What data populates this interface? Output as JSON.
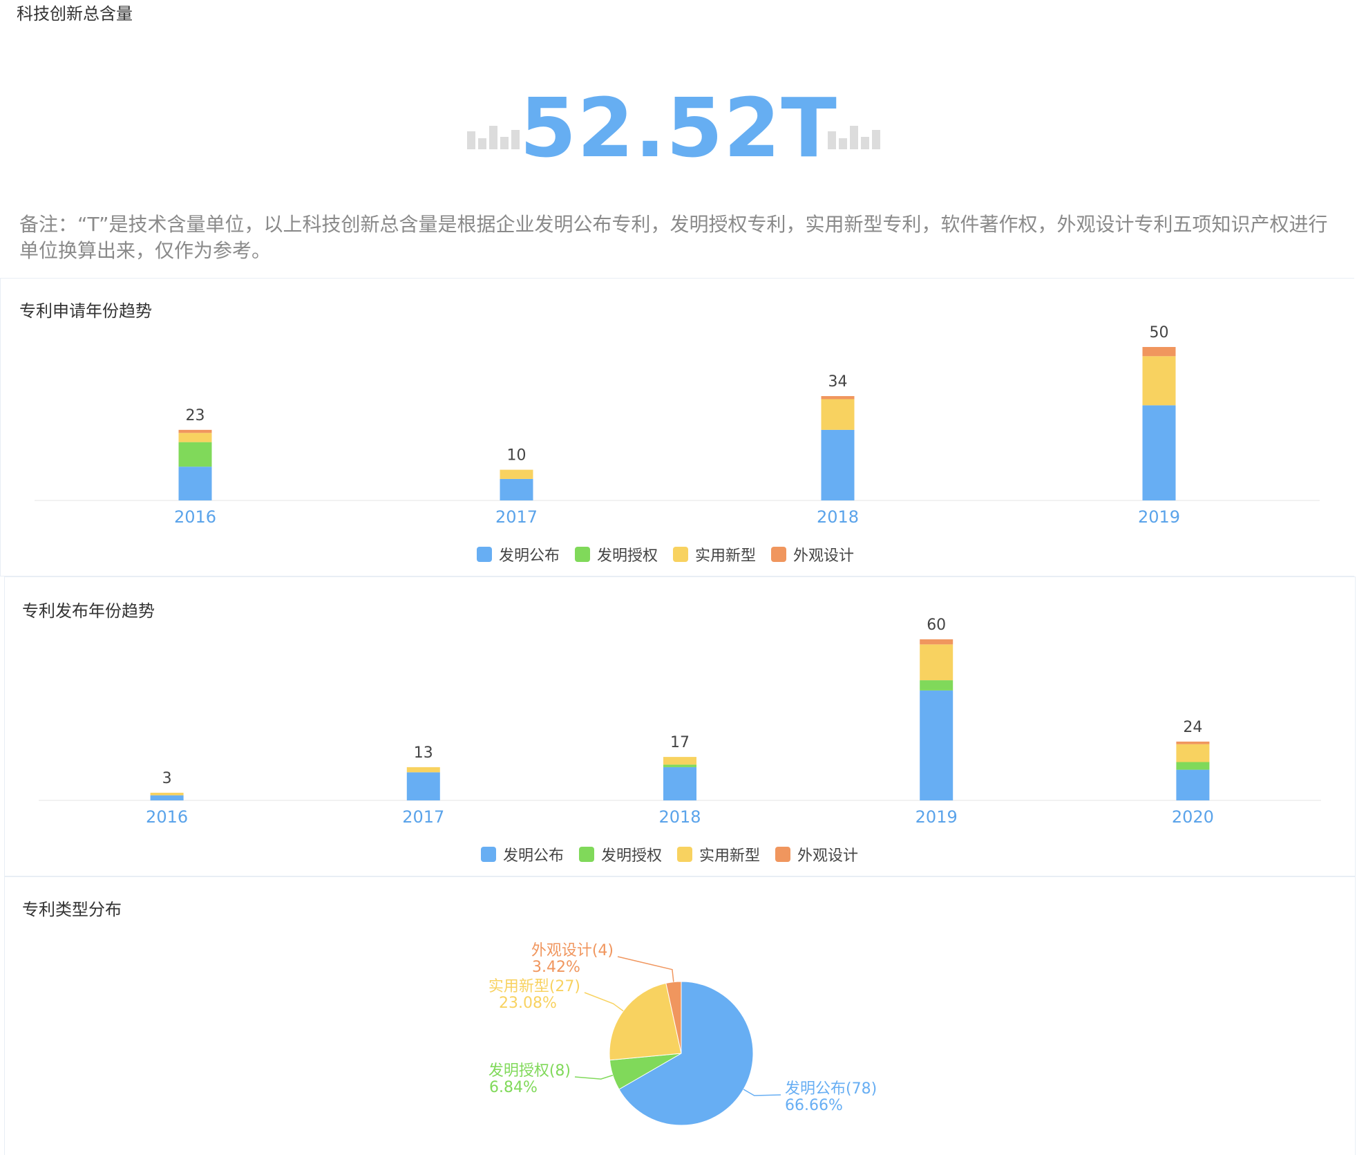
{
  "header": {
    "title": "科技创新总含量",
    "value": "52.52T",
    "note": "备注：“T”是技术含量单位，以上科技创新总含量是根据企业发明公布专利，发明授权专利，实用新型专利，软件著作权，外观设计专利五项知识产权进行单位换算出来，仅作为参考。"
  },
  "colors": {
    "invention_publish": "#67aef3",
    "invention_grant": "#80d95a",
    "utility_model": "#f8d260",
    "design": "#f0965e",
    "value": "#66aef2"
  },
  "chart_data": [
    {
      "type": "bar",
      "stacked": true,
      "title": "专利申请年份趋势",
      "categories": [
        "2016",
        "2017",
        "2018",
        "2019"
      ],
      "series": [
        {
          "name": "发明公布",
          "values": [
            11,
            7,
            23,
            31
          ]
        },
        {
          "name": "发明授权",
          "values": [
            8,
            0,
            0,
            0
          ]
        },
        {
          "name": "实用新型",
          "values": [
            3,
            3,
            10,
            16
          ]
        },
        {
          "name": "外观设计",
          "values": [
            1,
            0,
            1,
            3
          ]
        }
      ],
      "totals": [
        23,
        10,
        34,
        50
      ],
      "legend": "bottom",
      "ylim": [
        0,
        50
      ]
    },
    {
      "type": "bar",
      "stacked": true,
      "title": "专利发布年份趋势",
      "categories": [
        "2016",
        "2017",
        "2018",
        "2019",
        "2020"
      ],
      "series": [
        {
          "name": "发明公布",
          "values": [
            2,
            11,
            13,
            43,
            12
          ]
        },
        {
          "name": "发明授权",
          "values": [
            0,
            0,
            1,
            4,
            3
          ]
        },
        {
          "name": "实用新型",
          "values": [
            1,
            2,
            3,
            14,
            7
          ]
        },
        {
          "name": "外观设计",
          "values": [
            0,
            0,
            0,
            2,
            1
          ]
        }
      ],
      "totals": [
        3,
        13,
        17,
        60,
        24
      ],
      "legend": "bottom",
      "ylim": [
        0,
        60
      ]
    },
    {
      "type": "pie",
      "title": "专利类型分布",
      "slices": [
        {
          "name": "发明公布",
          "count": 78,
          "percent": "66.66%",
          "label": "发明公布(78)"
        },
        {
          "name": "发明授权",
          "count": 8,
          "percent": "6.84%",
          "label": "发明授权(8)"
        },
        {
          "name": "实用新型",
          "count": 27,
          "percent": "23.08%",
          "label": "实用新型(27)"
        },
        {
          "name": "外观设计",
          "count": 4,
          "percent": "3.42%",
          "label": "外观设计(4)"
        }
      ]
    }
  ]
}
